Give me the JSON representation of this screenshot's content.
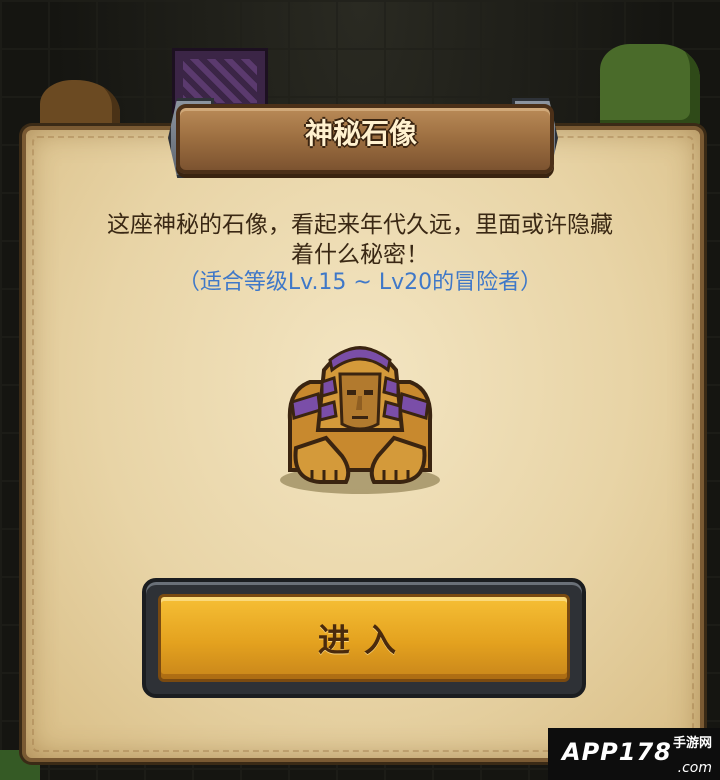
{
  "dialog": {
    "title": "神秘石像",
    "description": "这座神秘的石像，看起来年代久远，里面或许隐藏着什么秘密！",
    "level_hint": "（适合等级Lv.15 ~ Lv20的冒险者）",
    "enter_button_label": "进入"
  },
  "icons": {
    "sphinx": "sphinx-statue-icon"
  },
  "colors": {
    "hint_text": "#3f78c8",
    "button_gold": "#e4a21f",
    "panel_parchment": "#e8d4a6",
    "title_wood": "#9c6e40"
  },
  "watermark": {
    "brand": "APP178",
    "sub": "手游网",
    "domain": ".com"
  }
}
